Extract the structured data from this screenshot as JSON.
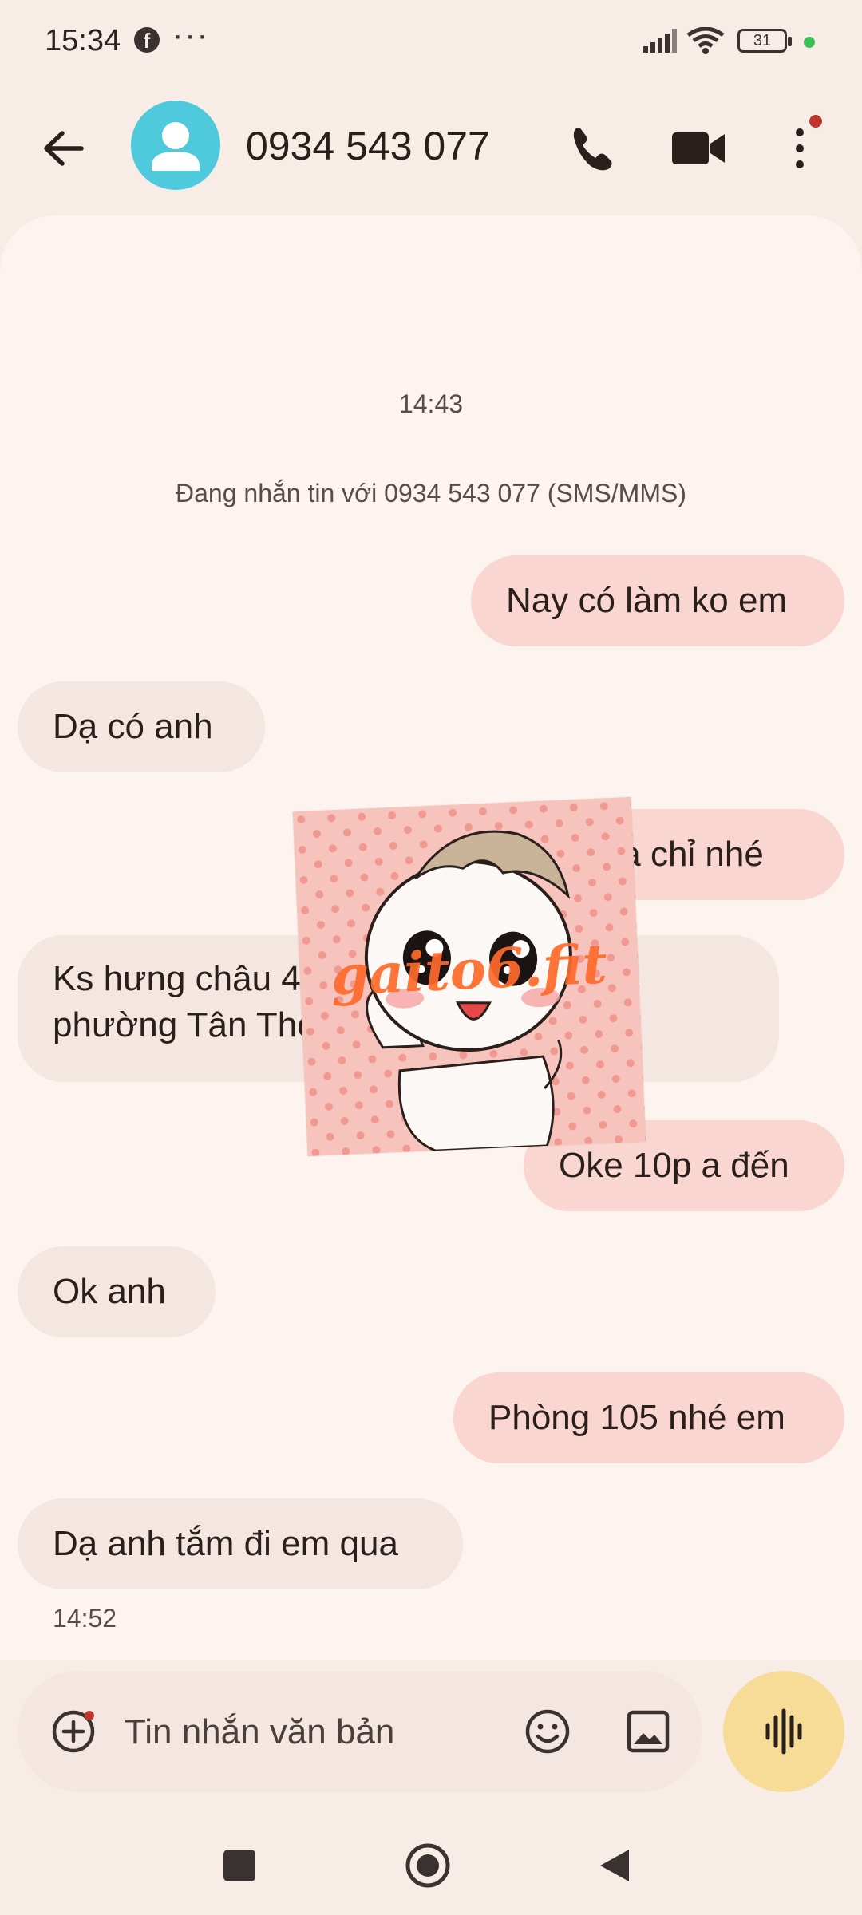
{
  "status_bar": {
    "time": "15:34",
    "facebook_glyph": "f",
    "more_glyph": "···",
    "battery": "31",
    "icons": [
      "facebook-icon",
      "more-icon",
      "signal-icon",
      "wifi-icon",
      "battery-icon",
      "active-dot-icon"
    ]
  },
  "header": {
    "contact": "0934 543 077",
    "icons": [
      "back-arrow-icon",
      "avatar-person-icon",
      "phone-icon",
      "video-call-icon",
      "more-vert-icon"
    ]
  },
  "conversation": {
    "timestamp": "14:43",
    "info": "Đang nhắn tin với 0934 543 077 (SMS/MMS)",
    "messages": [
      {
        "dir": "out",
        "text": "Nay có làm ko em"
      },
      {
        "dir": "in",
        "text": "Dạ có anh"
      },
      {
        "dir": "out",
        "text": "địa chỉ nhé"
      },
      {
        "dir": "in",
        "line1": "Ks hưng châu 4",
        "line2": "phường Tân Tho"
      },
      {
        "dir": "out",
        "text": "Oke 10p a đến"
      },
      {
        "dir": "in",
        "text": "Ok anh"
      },
      {
        "dir": "out",
        "text": "Phòng 105 nhé em"
      },
      {
        "dir": "in",
        "text": "Dạ anh tắm đi em qua"
      }
    ],
    "last_time": "14:52"
  },
  "sticker": {
    "watermark": "gaito6.fit",
    "colors": {
      "bg": "#f7c3bd",
      "dots": "#ee8f86",
      "text": "#ff6a2b"
    }
  },
  "composer": {
    "placeholder": "Tin nhắn văn bản",
    "icons": [
      "add-attachment-icon",
      "emoji-icon",
      "gallery-icon",
      "voice-waveform-icon"
    ]
  },
  "nav_bar": {
    "icons": [
      "recents-square-icon",
      "home-circle-icon",
      "back-triangle-icon"
    ]
  },
  "colors": {
    "background": "#f8ece6",
    "conversation_bg": "#fdf3ef",
    "outgoing_bubble": "#f9d6cf",
    "incoming_bubble": "#f4e7e2",
    "avatar": "#4fc9dc",
    "voice_button": "#f7dc98",
    "notification_badge": "#c0362c",
    "active_dot": "#3fbf5a"
  }
}
